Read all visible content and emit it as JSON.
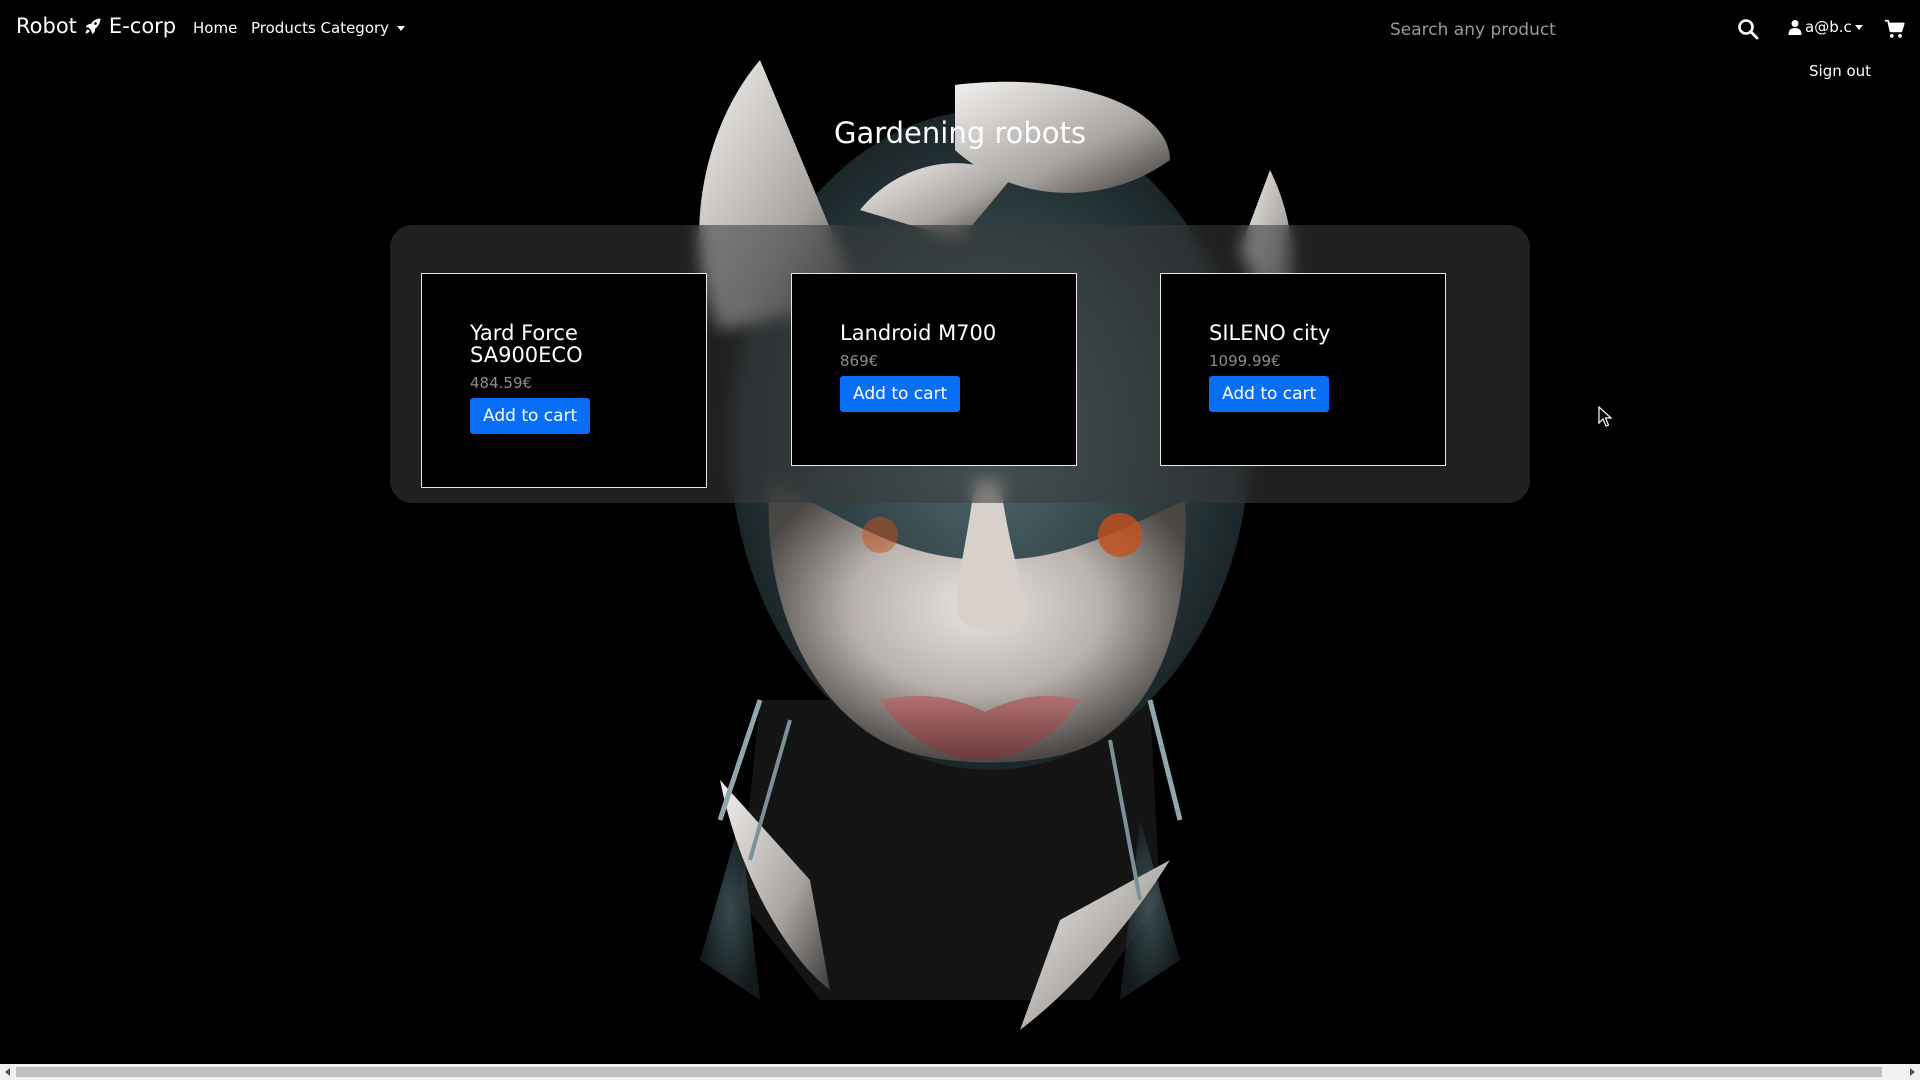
{
  "navbar": {
    "brand_left": "Robot",
    "brand_right": "E-corp",
    "home_label": "Home",
    "products_category_label": "Products Category",
    "search_placeholder": "Search any product",
    "user_email": "a@b.c",
    "sign_out_label": "Sign out"
  },
  "main": {
    "title": "Gardening robots",
    "products": [
      {
        "name": "Yard Force SA900ECO",
        "price": "484.59€",
        "button_label": "Add to cart"
      },
      {
        "name": "Landroid M700",
        "price": "869€",
        "button_label": "Add to cart"
      },
      {
        "name": "SILENO city",
        "price": "1099.99€",
        "button_label": "Add to cart"
      }
    ]
  },
  "colors": {
    "background": "#000000",
    "accent_button": "#0a6ff7",
    "price_text": "#8d8d8d",
    "panel": "#3a3a3a"
  },
  "icons": {
    "brand": "rocket-icon",
    "search": "search-icon",
    "user": "user-icon",
    "cart": "shopping-cart-icon"
  }
}
